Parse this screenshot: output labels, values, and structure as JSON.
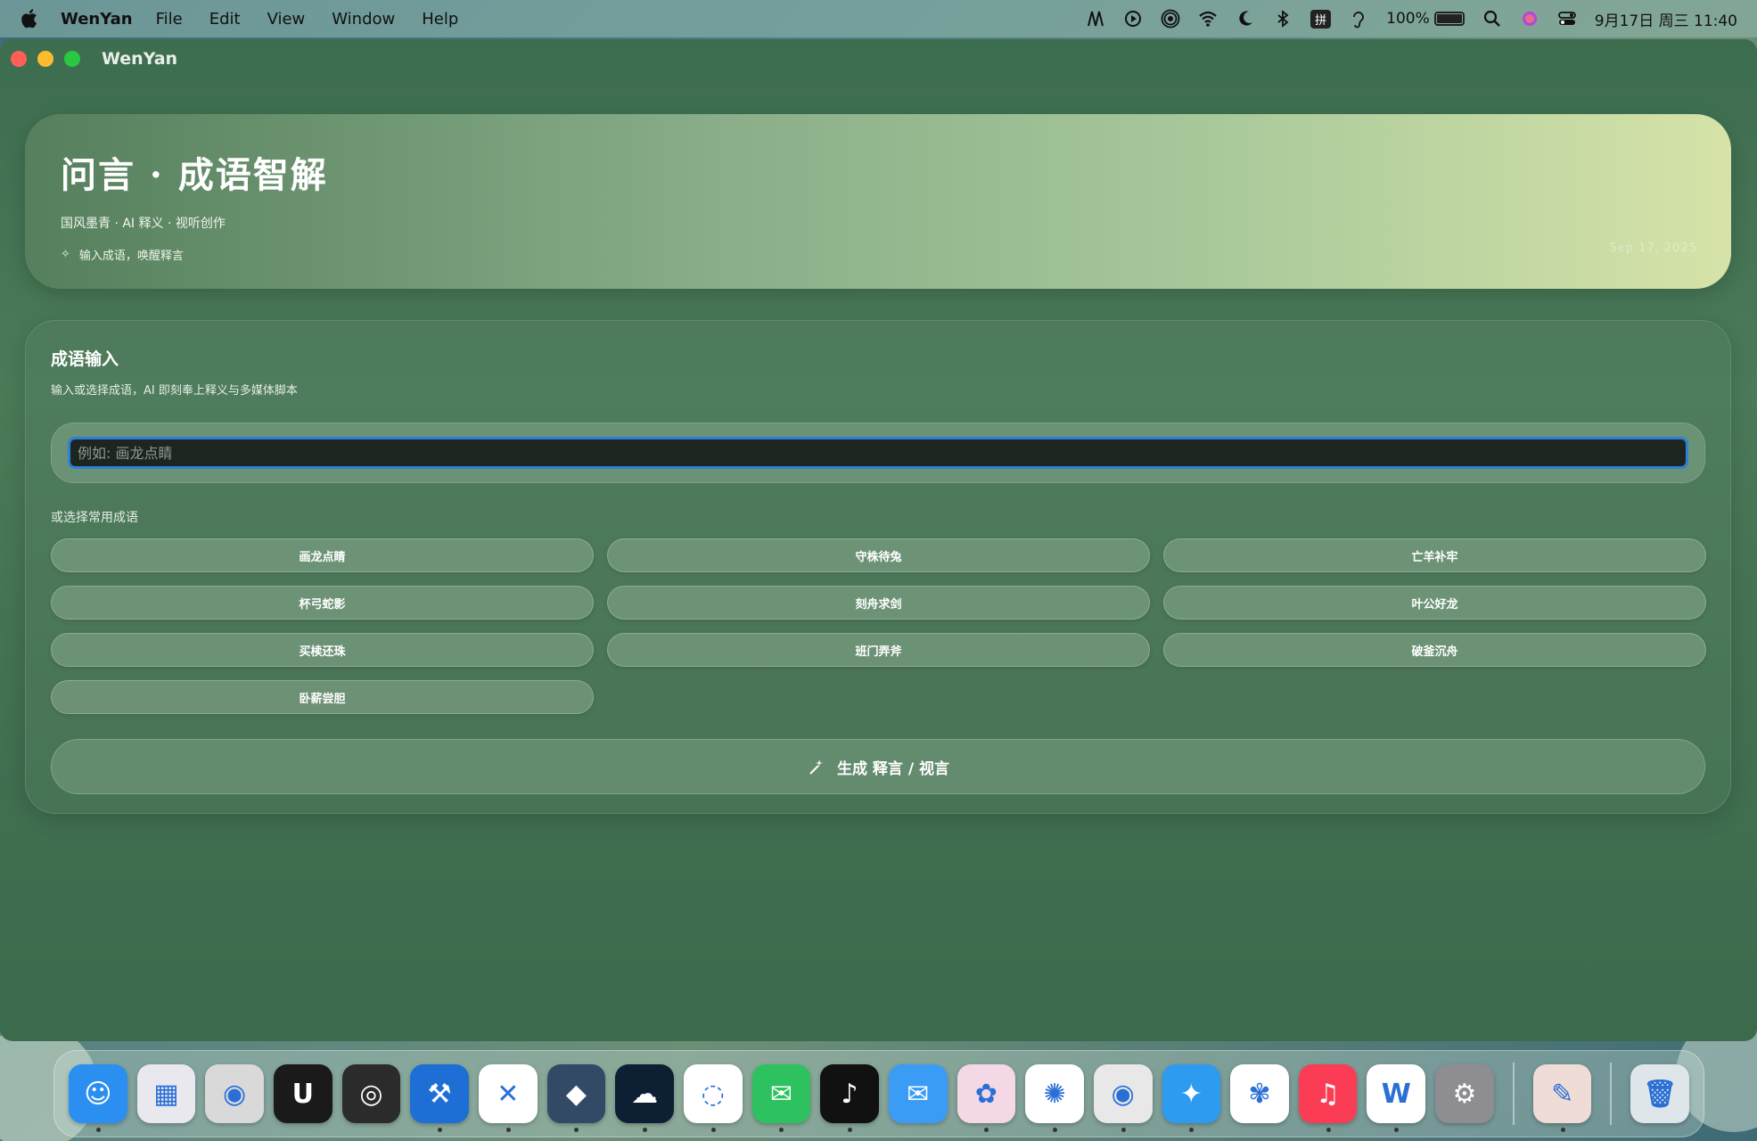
{
  "menubar": {
    "app_name": "WenYan",
    "menus": [
      "File",
      "Edit",
      "View",
      "Window",
      "Help"
    ],
    "input_method": "拼",
    "battery": "100%",
    "datetime": "9月17日 周三 11:40"
  },
  "window": {
    "title": "WenYan"
  },
  "hero": {
    "title": "问言 · 成语智解",
    "subtitle": "国风墨青 · AI 释义 · 视听创作",
    "hint": "输入成语，唤醒释言",
    "date": "Sep 17, 2025"
  },
  "panel": {
    "title": "成语输入",
    "description": "输入或选择成语，AI 即刻奉上释义与多媒体脚本",
    "input_placeholder": "例如: 画龙点睛",
    "input_value": "",
    "common_label": "或选择常用成语",
    "idioms": [
      "画龙点睛",
      "守株待兔",
      "亡羊补牢",
      "杯弓蛇影",
      "刻舟求剑",
      "叶公好龙",
      "买椟还珠",
      "班门弄斧",
      "破釜沉舟",
      "卧薪尝胆"
    ],
    "generate_label": "生成 释言 / 视言"
  },
  "colors": {
    "accent_focus": "#2f7fd8",
    "window_bg": "#416f50",
    "hero_end": "#d6e3a8"
  },
  "dock": {
    "apps": [
      {
        "name": "finder-icon",
        "glyph": "☺",
        "color": "#2a8ff0",
        "running": true
      },
      {
        "name": "launchpad-icon",
        "glyph": "▦",
        "color": "#e8e8ee",
        "running": false
      },
      {
        "name": "screenshot-icon",
        "glyph": "◉",
        "color": "#d9d9d9",
        "running": false
      },
      {
        "name": "unreal-icon",
        "glyph": "U",
        "color": "#1a1a1a",
        "running": false
      },
      {
        "name": "blender-icon",
        "glyph": "◎",
        "color": "#2b2b2b",
        "running": false
      },
      {
        "name": "xcode-icon",
        "glyph": "⚒",
        "color": "#1d6fd6",
        "running": true
      },
      {
        "name": "vscode-icon",
        "glyph": "✕",
        "color": "#ffffff",
        "running": true
      },
      {
        "name": "mysql-workbench-icon",
        "glyph": "◆",
        "color": "#334a66",
        "running": true
      },
      {
        "name": "cloud-app-icon",
        "glyph": "☁",
        "color": "#0d1f33",
        "running": true
      },
      {
        "name": "chat-assistant-icon",
        "glyph": "◌",
        "color": "#ffffff",
        "running": true
      },
      {
        "name": "wechat-icon",
        "glyph": "✉",
        "color": "#2dc160",
        "running": true
      },
      {
        "name": "tiktok-icon",
        "glyph": "♪",
        "color": "#111111",
        "running": true
      },
      {
        "name": "mail-icon",
        "glyph": "✉",
        "color": "#3b9cf5",
        "running": false
      },
      {
        "name": "pony-app-icon",
        "glyph": "✿",
        "color": "#f5d8e6",
        "running": true
      },
      {
        "name": "chatgpt-icon",
        "glyph": "✺",
        "color": "#ffffff",
        "running": true
      },
      {
        "name": "chrome-icon",
        "glyph": "◉",
        "color": "#e8e8e8",
        "running": true
      },
      {
        "name": "safari-icon",
        "glyph": "✦",
        "color": "#2d9bf0",
        "running": true
      },
      {
        "name": "photos-icon",
        "glyph": "✾",
        "color": "#ffffff",
        "running": false
      },
      {
        "name": "music-icon",
        "glyph": "♫",
        "color": "#fa3d55",
        "running": true
      },
      {
        "name": "wps-icon",
        "glyph": "W",
        "color": "#ffffff",
        "running": true
      },
      {
        "name": "system-settings-icon",
        "glyph": "⚙",
        "color": "#8d8d92",
        "running": false
      }
    ],
    "pinned_after_separator": [
      {
        "name": "game-app-icon",
        "glyph": "✎",
        "color": "#f0dcd6",
        "running": true
      }
    ],
    "trash": {
      "name": "trash-icon",
      "glyph": "🗑",
      "color": "#dfe6ea"
    }
  }
}
